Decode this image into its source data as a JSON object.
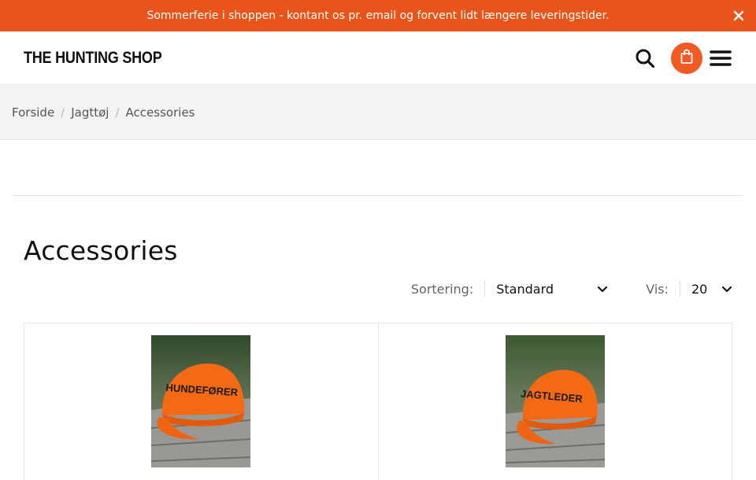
{
  "announcement": {
    "text": "Sommerferie i shoppen - kontant os pr. email og forvent lidt længere leveringstider.",
    "close_icon": "close-icon"
  },
  "header": {
    "logo": "THE HUNTING SHOP",
    "icons": [
      "search-icon",
      "shopping-bag-icon",
      "hamburger-menu-icon"
    ],
    "accent_color": "#f15a22"
  },
  "breadcrumb": [
    "Forside",
    "Jagttøj",
    "Accessories"
  ],
  "page": {
    "title": "Accessories"
  },
  "toolbar": {
    "sort_label": "Sortering:",
    "sort_value": "Standard",
    "show_label": "Vis:",
    "show_value": "20"
  },
  "products": [
    {
      "cap_text": "HUNDEFØRER",
      "cap_color": "#f46a14"
    },
    {
      "cap_text": "JAGTLEDER",
      "cap_color": "#f46a14"
    }
  ],
  "colors": {
    "announcement_bg": "#e8541a",
    "breadcrumb_bg": "#f3f3f4"
  }
}
